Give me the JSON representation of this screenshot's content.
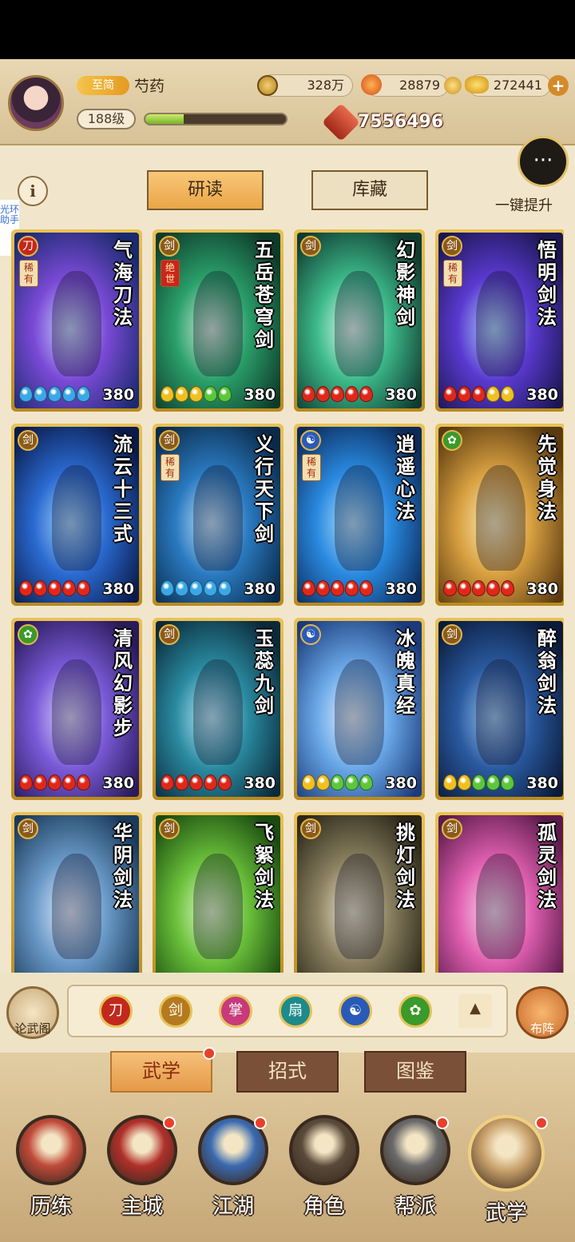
{
  "player": {
    "vip_label": "至简",
    "name": "芍药",
    "level": "188级",
    "exp_fraction": 0.27,
    "silver": "328万",
    "jade": "28879",
    "gold": "272441",
    "power": "7556496"
  },
  "top_actions": {
    "one_key_upgrade": "一键提升",
    "info": "i",
    "side_helper": "光环助手"
  },
  "tabs": [
    {
      "label": "研读",
      "active": true
    },
    {
      "label": "库藏",
      "active": false
    }
  ],
  "cards": [
    {
      "name": "气海刀法",
      "rarity": "稀有",
      "badge": "blade",
      "score": "380",
      "dots": [
        "blue",
        "blue",
        "blue",
        "blue",
        "blue"
      ],
      "bg": [
        "#1a2a6e",
        "#7a4ad6",
        "#c9d8ff"
      ]
    },
    {
      "name": "五岳苍穹剑",
      "rarity": "绝世",
      "badge": "sword",
      "score": "380",
      "dots": [
        "yellow",
        "yellow",
        "yellow",
        "green",
        "green"
      ],
      "bg": [
        "#0e3a2a",
        "#2aa06a",
        "#d8f0e0"
      ]
    },
    {
      "name": "幻影神剑",
      "rarity": "",
      "badge": "sword",
      "score": "380",
      "dots": [
        "red",
        "red",
        "red",
        "red",
        "red"
      ],
      "bg": [
        "#0f3a30",
        "#3cb98a",
        "#e8fff4"
      ]
    },
    {
      "name": "悟明剑法",
      "rarity": "稀有",
      "badge": "sword",
      "score": "380",
      "dots": [
        "red",
        "red",
        "red",
        "yellow",
        "yellow"
      ],
      "bg": [
        "#1a1650",
        "#5a3ad0",
        "#b0d8ff"
      ]
    },
    {
      "name": "流云十三式",
      "rarity": "",
      "badge": "sword",
      "score": "380",
      "dots": [
        "red",
        "red",
        "red",
        "red",
        "red"
      ],
      "bg": [
        "#0a1a4a",
        "#2a6ad0",
        "#a8d8ff"
      ]
    },
    {
      "name": "义行天下剑",
      "rarity": "稀有",
      "badge": "sword",
      "score": "380",
      "dots": [
        "blue",
        "blue",
        "blue",
        "blue",
        "blue"
      ],
      "bg": [
        "#0a2a4a",
        "#2a7ac0",
        "#c8e8ff"
      ]
    },
    {
      "name": "逍遥心法",
      "rarity": "稀有",
      "badge": "taiji",
      "score": "380",
      "dots": [
        "red",
        "red",
        "red",
        "red",
        "red"
      ],
      "bg": [
        "#0a2a5a",
        "#2a8ae0",
        "#b8e4ff"
      ]
    },
    {
      "name": "先觉身法",
      "rarity": "",
      "badge": "leaf",
      "score": "380",
      "dots": [
        "red",
        "red",
        "red",
        "red",
        "red"
      ],
      "bg": [
        "#5a3a10",
        "#d8a040",
        "#fff0c0"
      ]
    },
    {
      "name": "清风幻影步",
      "rarity": "",
      "badge": "leaf",
      "score": "380",
      "dots": [
        "red",
        "red",
        "red",
        "red",
        "red"
      ],
      "bg": [
        "#2a1a5a",
        "#7a5ad8",
        "#e0d8ff"
      ]
    },
    {
      "name": "玉蕊九剑",
      "rarity": "",
      "badge": "sword",
      "score": "380",
      "dots": [
        "red",
        "red",
        "red",
        "red",
        "red"
      ],
      "bg": [
        "#0a2a3a",
        "#2a8aa0",
        "#c0f0ff"
      ]
    },
    {
      "name": "冰魄真经",
      "rarity": "",
      "badge": "taiji",
      "score": "380",
      "dots": [
        "yellow",
        "yellow",
        "green",
        "green",
        "green"
      ],
      "bg": [
        "#1a3a7a",
        "#6aa8e8",
        "#e8f4ff"
      ]
    },
    {
      "name": "醉翁剑法",
      "rarity": "",
      "badge": "sword",
      "score": "380",
      "dots": [
        "yellow",
        "yellow",
        "green",
        "green",
        "green"
      ],
      "bg": [
        "#0a1a3a",
        "#2a5aa0",
        "#a0c8f0"
      ]
    },
    {
      "name": "华阴剑法",
      "rarity": "",
      "badge": "sword",
      "score": "",
      "dots": [],
      "bg": [
        "#1a3a5a",
        "#6a9ac8",
        "#e8f0ff"
      ]
    },
    {
      "name": "飞絮剑法",
      "rarity": "",
      "badge": "sword",
      "score": "",
      "dots": [],
      "bg": [
        "#1a4a10",
        "#6ac03a",
        "#e8ffd0"
      ]
    },
    {
      "name": "挑灯剑法",
      "rarity": "",
      "badge": "sword",
      "score": "",
      "dots": [],
      "bg": [
        "#2a2618",
        "#8a8060",
        "#f0ead0"
      ]
    },
    {
      "name": "孤灵剑法",
      "rarity": "",
      "badge": "sword",
      "score": "",
      "dots": [],
      "bg": [
        "#5a1a4a",
        "#e060b0",
        "#ffe0f0"
      ]
    }
  ],
  "filter": {
    "left_button": "论武阁",
    "right_button": "布阵",
    "icons": [
      {
        "name": "blade-filter",
        "color": "#c2281c"
      },
      {
        "name": "sword-filter",
        "color": "#b57a1e"
      },
      {
        "name": "palm-filter",
        "color": "#c83a7a"
      },
      {
        "name": "fan-filter",
        "color": "#1e8a8a"
      },
      {
        "name": "taiji-filter",
        "color": "#2a5ab8"
      },
      {
        "name": "leaf-filter",
        "color": "#3a9a2a"
      },
      {
        "name": "up-filter",
        "color": "#f4e6c4"
      }
    ]
  },
  "bottom_tabs": [
    {
      "label": "武学",
      "active": true
    },
    {
      "label": "招式",
      "active": false
    },
    {
      "label": "图鉴",
      "active": false
    }
  ],
  "nav": [
    {
      "label": "历练",
      "color": "#c04a3a",
      "dot": false
    },
    {
      "label": "主城",
      "color": "#b0302a",
      "dot": true
    },
    {
      "label": "江湖",
      "color": "#3a6ab0",
      "dot": true
    },
    {
      "label": "角色",
      "color": "#5a4a3a",
      "dot": false
    },
    {
      "label": "帮派",
      "color": "#6a6a6a",
      "dot": true
    },
    {
      "label": "武学",
      "color": "#c8a06a",
      "dot": true
    }
  ]
}
